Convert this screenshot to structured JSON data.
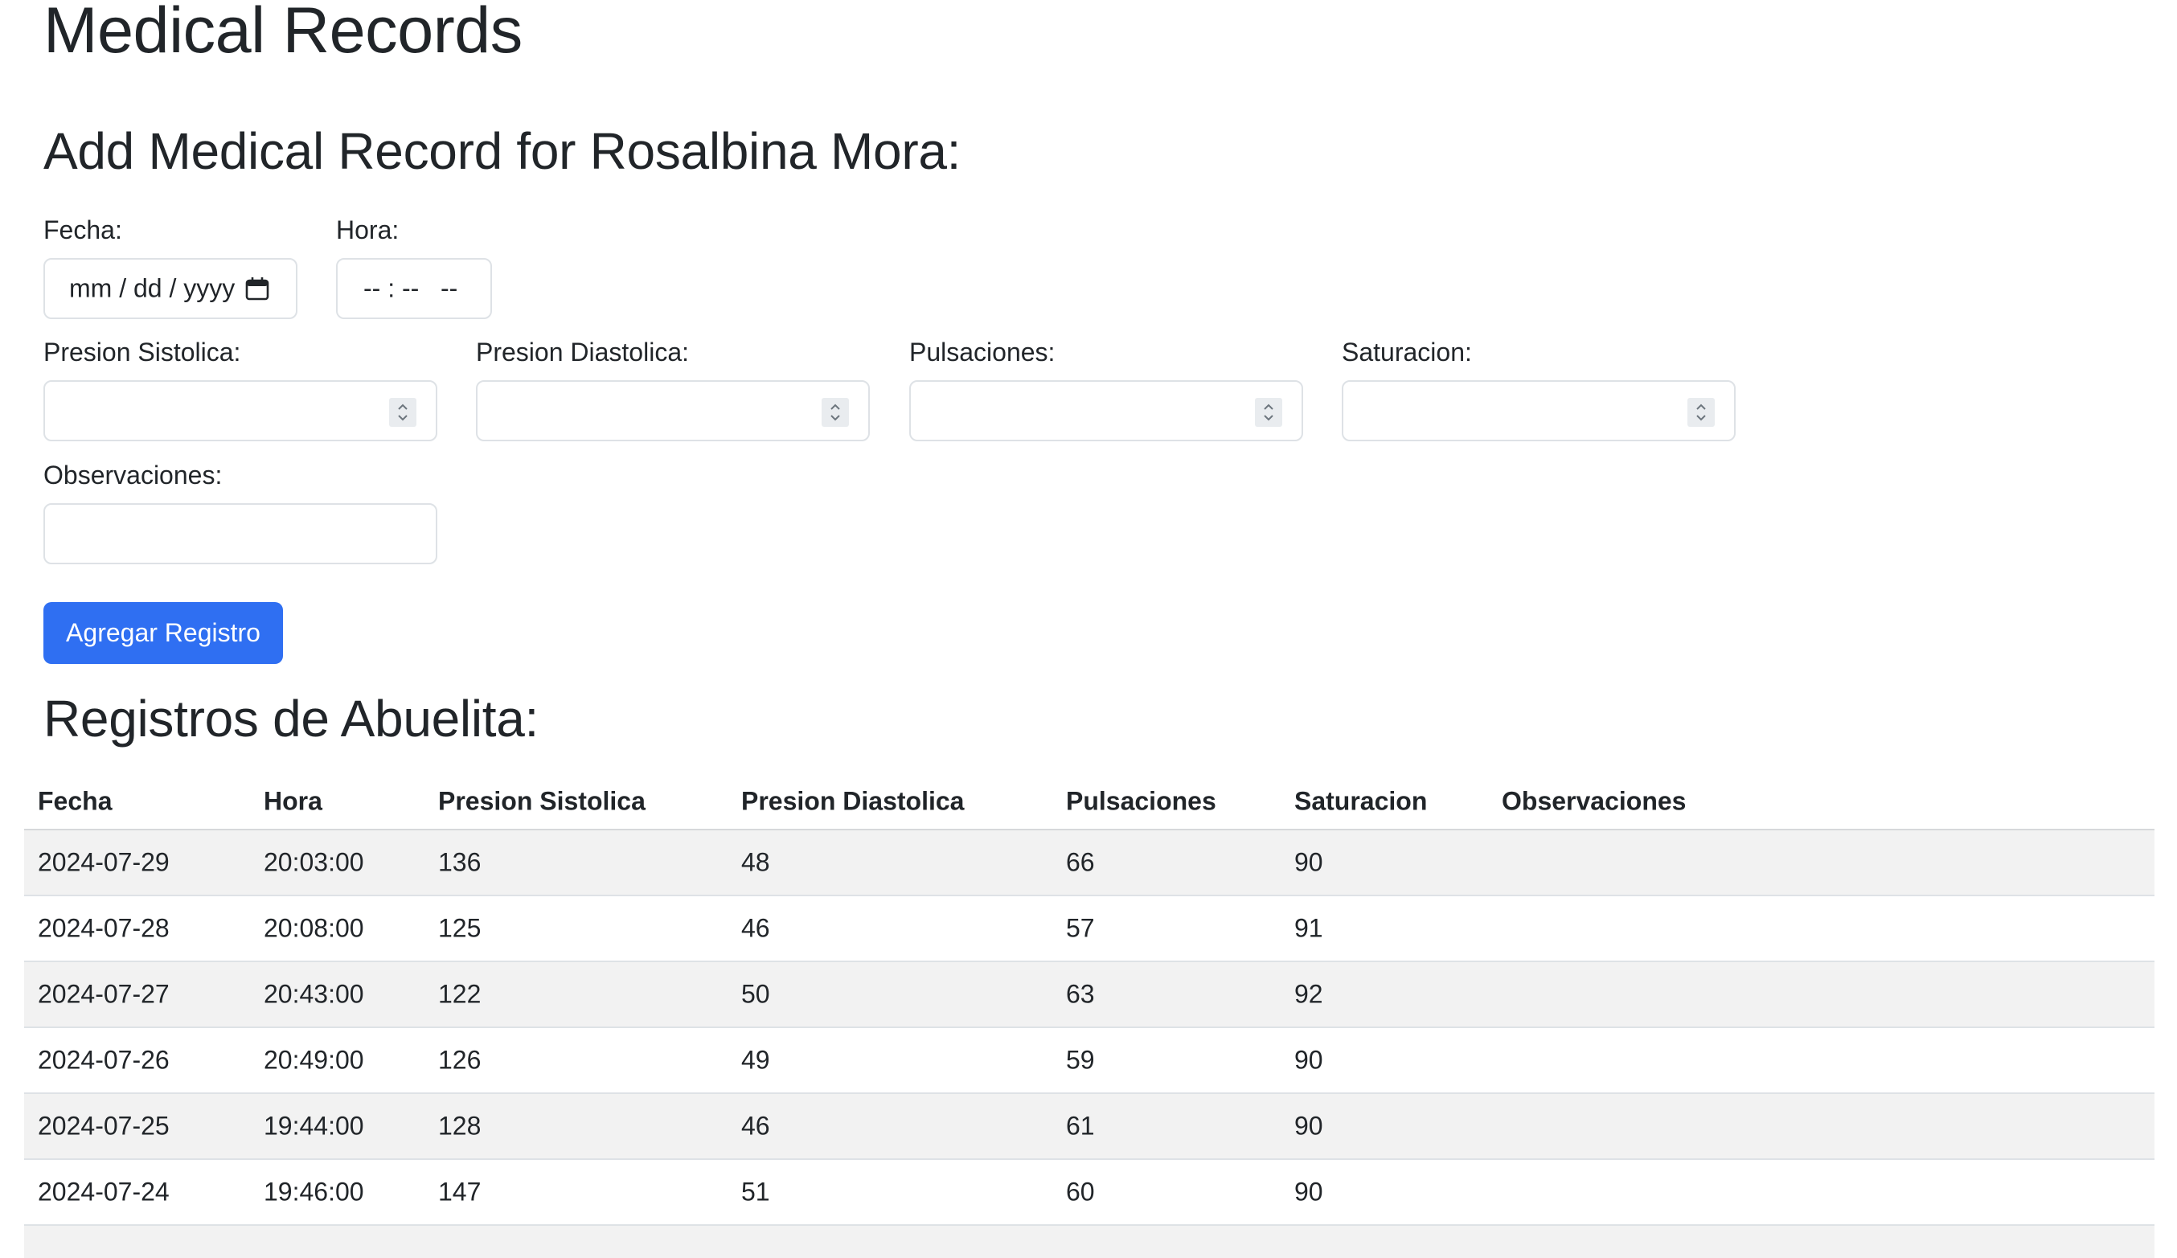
{
  "page_title": "Medical Records",
  "form": {
    "title": "Add Medical Record for Rosalbina Mora:",
    "fecha_label": "Fecha:",
    "fecha_placeholder": "mm / dd / yyyy",
    "hora_label": "Hora:",
    "hora_placeholder": "-- : --   --",
    "sistolica_label": "Presion Sistolica:",
    "diastolica_label": "Presion Diastolica:",
    "pulsaciones_label": "Pulsaciones:",
    "saturacion_label": "Saturacion:",
    "observaciones_label": "Observaciones:",
    "submit_label": "Agregar Registro"
  },
  "records": {
    "title": "Registros de Abuelita:",
    "columns": [
      "Fecha",
      "Hora",
      "Presion Sistolica",
      "Presion Diastolica",
      "Pulsaciones",
      "Saturacion",
      "Observaciones"
    ],
    "rows": [
      {
        "fecha": "2024-07-29",
        "hora": "20:03:00",
        "sistolica": "136",
        "diastolica": "48",
        "pulsaciones": "66",
        "saturacion": "90",
        "observaciones": ""
      },
      {
        "fecha": "2024-07-28",
        "hora": "20:08:00",
        "sistolica": "125",
        "diastolica": "46",
        "pulsaciones": "57",
        "saturacion": "91",
        "observaciones": ""
      },
      {
        "fecha": "2024-07-27",
        "hora": "20:43:00",
        "sistolica": "122",
        "diastolica": "50",
        "pulsaciones": "63",
        "saturacion": "92",
        "observaciones": ""
      },
      {
        "fecha": "2024-07-26",
        "hora": "20:49:00",
        "sistolica": "126",
        "diastolica": "49",
        "pulsaciones": "59",
        "saturacion": "90",
        "observaciones": ""
      },
      {
        "fecha": "2024-07-25",
        "hora": "19:44:00",
        "sistolica": "128",
        "diastolica": "46",
        "pulsaciones": "61",
        "saturacion": "90",
        "observaciones": ""
      },
      {
        "fecha": "2024-07-24",
        "hora": "19:46:00",
        "sistolica": "147",
        "diastolica": "51",
        "pulsaciones": "60",
        "saturacion": "90",
        "observaciones": ""
      }
    ]
  },
  "colors": {
    "primary": "#2f6ff2",
    "text": "#212529",
    "stripe": "#f2f2f2",
    "border": "#dee2e6"
  },
  "icons": {
    "date_picker": "calendar-icon",
    "number_spinner": "spinner-arrows-icon"
  }
}
